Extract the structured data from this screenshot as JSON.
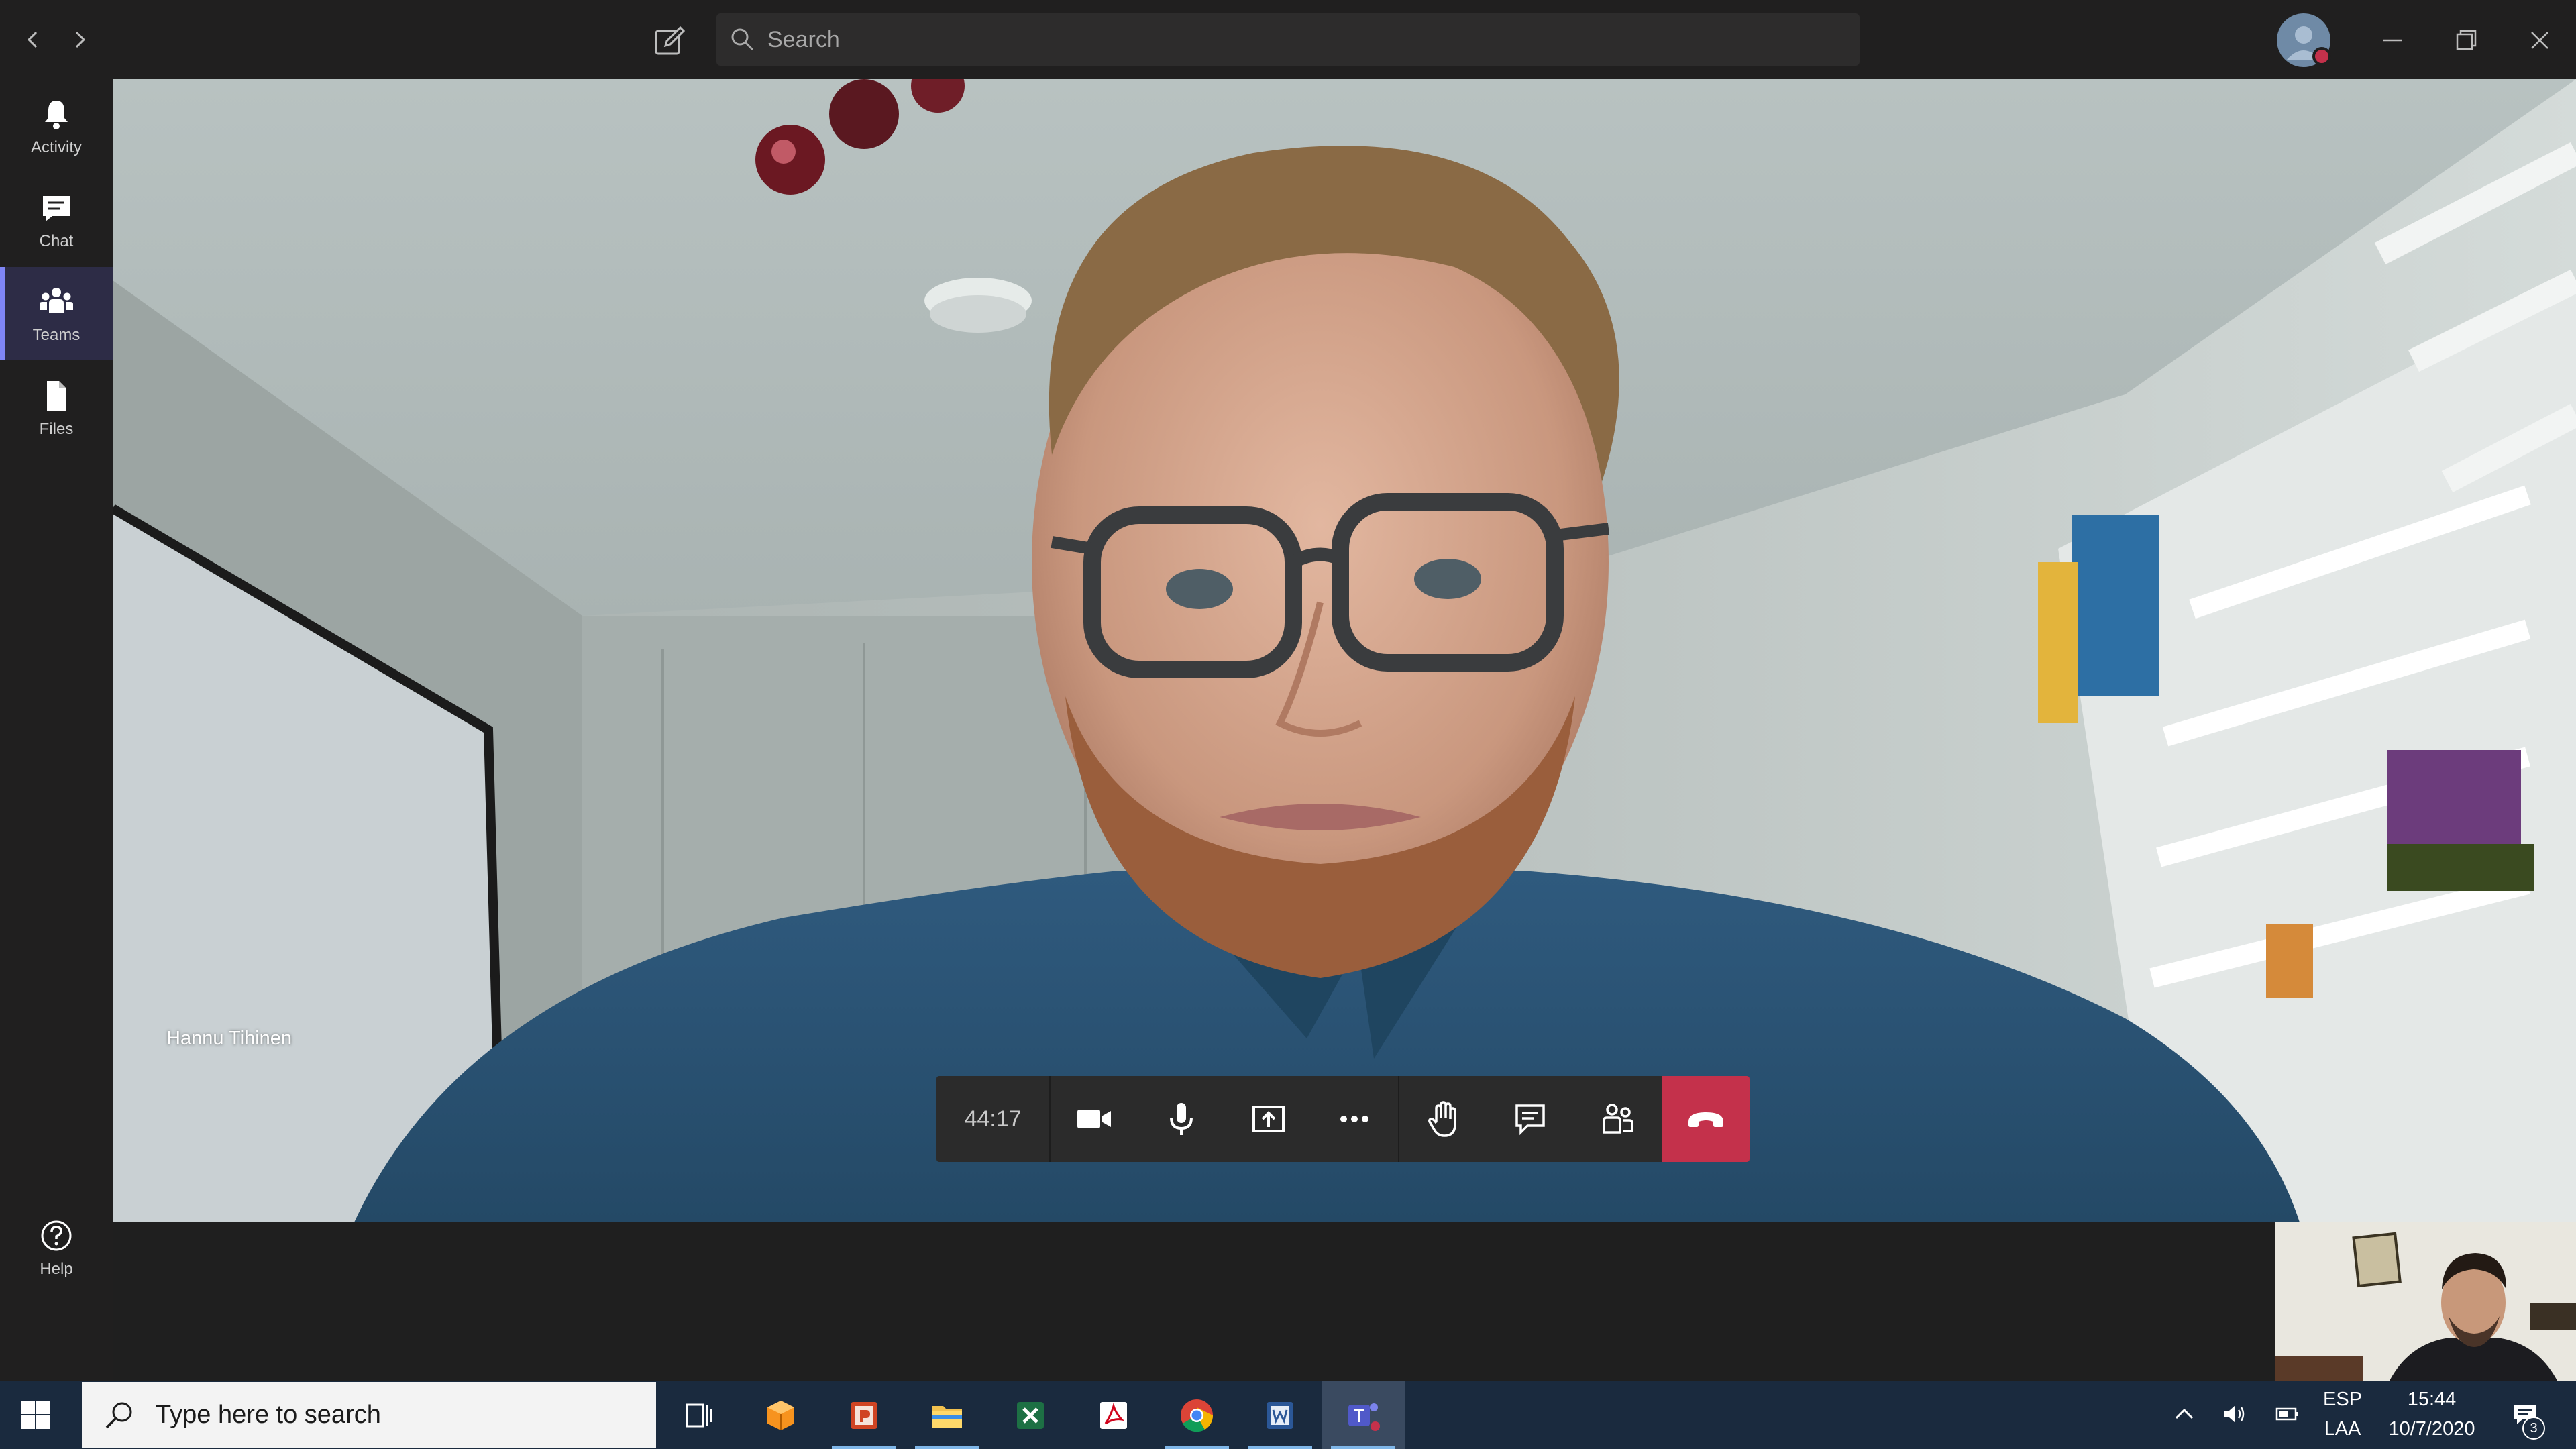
{
  "titlebar": {
    "search_placeholder": "Search"
  },
  "rail": {
    "items": [
      {
        "label": "Activity",
        "icon": "bell-icon"
      },
      {
        "label": "Chat",
        "icon": "chat-icon"
      },
      {
        "label": "Teams",
        "icon": "teams-icon",
        "active": true
      },
      {
        "label": "Files",
        "icon": "file-icon"
      }
    ],
    "help_label": "Help"
  },
  "call": {
    "participant_name": "Hannu Tihinen",
    "timer": "44:17",
    "controls": [
      "camera-icon",
      "microphone-icon",
      "share-screen-icon",
      "more-options-icon",
      "raise-hand-icon",
      "chat-icon",
      "participants-icon",
      "hang-up-icon"
    ]
  },
  "taskbar": {
    "search_placeholder": "Type here to search",
    "apps": [
      "task-view-icon",
      "app-3d-icon",
      "powerpoint-icon",
      "file-explorer-icon",
      "excel-icon",
      "acrobat-icon",
      "chrome-icon",
      "word-icon",
      "teams-icon"
    ],
    "language_top": "ESP",
    "language_bottom": "LAA",
    "time": "15:44",
    "date": "10/7/2020",
    "notification_count": "3"
  },
  "colors": {
    "accent": "#7f85f5",
    "hangup": "#c4314b",
    "titlebar": "#201f1f",
    "taskbar": "#1a2a3e"
  }
}
